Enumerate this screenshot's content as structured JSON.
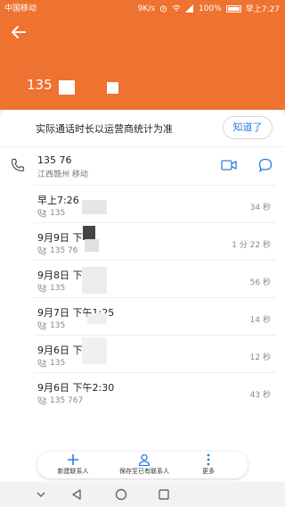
{
  "status_bar": {
    "left_text": "中国移动",
    "network_speed": "9K/s",
    "battery_percent": "100%",
    "time": "早上7:27"
  },
  "header": {
    "number_prefix": "135",
    "accent_color": "#ee7230"
  },
  "notice": {
    "text": "实际通话时长以运营商统计为准",
    "button_label": "知道了"
  },
  "contact": {
    "number": "135 76",
    "location": "江西赣州 移动"
  },
  "call_log": [
    {
      "time": "早上7:26",
      "number": "135",
      "duration": "34 秒"
    },
    {
      "time": "9月9日 下午",
      "number": "135 76",
      "duration": "1 分 22 秒"
    },
    {
      "time": "9月8日 下午",
      "number": "135",
      "duration": "56 秒"
    },
    {
      "time": "9月7日 下午1:25",
      "number": "135",
      "duration": "14 秒"
    },
    {
      "time": "9月6日 下午",
      "number": "135",
      "duration": "12 秒"
    },
    {
      "time": "9月6日 下午2:30",
      "number": "135 767",
      "duration": "43 秒"
    }
  ],
  "bottom_actions": {
    "new_contact": "新建联系人",
    "save_existing": "保存至已有联系人",
    "more": "更多"
  }
}
